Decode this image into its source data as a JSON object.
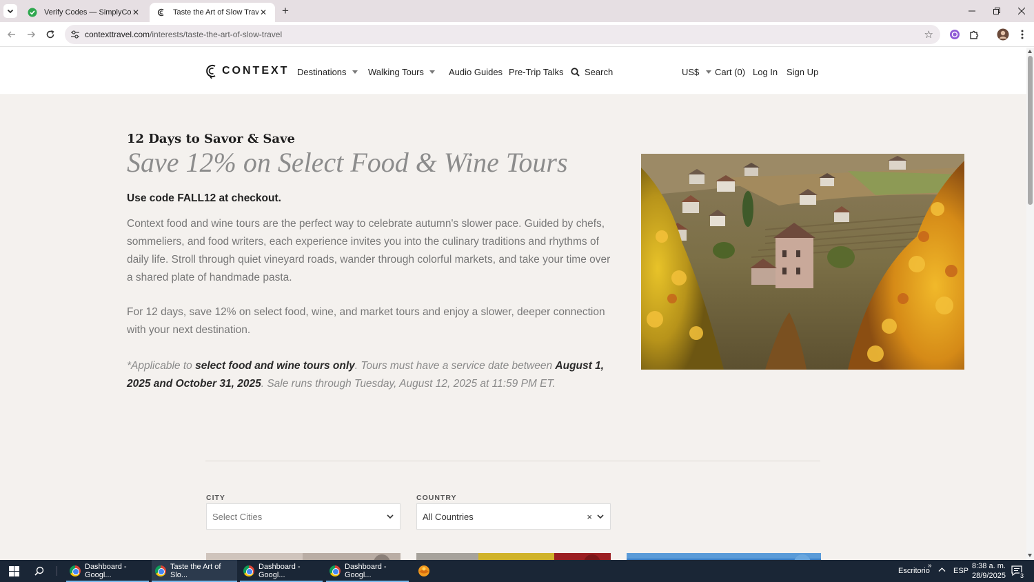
{
  "browser": {
    "tabs": [
      {
        "title": "Verify Codes — SimplyCodes",
        "active": false
      },
      {
        "title": "Taste the Art of Slow Travel",
        "active": true
      }
    ],
    "address": {
      "domain": "contexttravel.com",
      "path": "/interests/taste-the-art-of-slow-travel"
    }
  },
  "header": {
    "logo_text": "CONTEXT",
    "nav": {
      "destinations": "Destinations",
      "walking_tours": "Walking Tours",
      "audio_guides": "Audio Guides",
      "pre_trip_talks": "Pre-Trip Talks",
      "search": "Search",
      "currency": "US$",
      "cart": "Cart (0)",
      "login": "Log In",
      "signup": "Sign Up"
    }
  },
  "promo": {
    "kicker": "12 Days to Savor & Save",
    "headline": "Save 12% on Select Food & Wine Tours",
    "code_line": "Use code FALL12 at checkout.",
    "paragraph1": "Context food and wine tours are the perfect way to celebrate autumn's slower pace. Guided by chefs, sommeliers, and food writers, each experience invites you into the culinary traditions and rhythms of daily life. Stroll through quiet vineyard roads, wander through colorful markets, and take your time over a shared plate of handmade pasta.",
    "paragraph2": "For 12 days, save 12% on select food, wine, and market tours and enjoy a slower, deeper connection with your next destination.",
    "fine_print": {
      "part1": "*Applicable to ",
      "bold1": "select food and wine tours only",
      "part2": ". Tours must have a service date between ",
      "bold2": "August 1, 2025 and October 31, 2025",
      "part3": ". Sale runs through Tuesday, August 12, 2025 at 11:59 PM ET."
    }
  },
  "filters": {
    "city_label": "CITY",
    "city_placeholder": "Select Cities",
    "country_label": "COUNTRY",
    "country_value": "All Countries",
    "clear_symbol": "×"
  },
  "taskbar": {
    "buttons": [
      "Dashboard - Googl...",
      "Taste the Art of Slo...",
      "Dashboard - Googl...",
      "Dashboard - Googl..."
    ],
    "desktop_label": "Escritorio",
    "language": "ESP",
    "time": "8:38 a. m.",
    "date": "28/9/2025",
    "notification_count": "3"
  },
  "colors": {
    "page_background": "#f4f1ee",
    "headline_gray": "#8c8c8c",
    "taskbar": "#1a2636"
  }
}
